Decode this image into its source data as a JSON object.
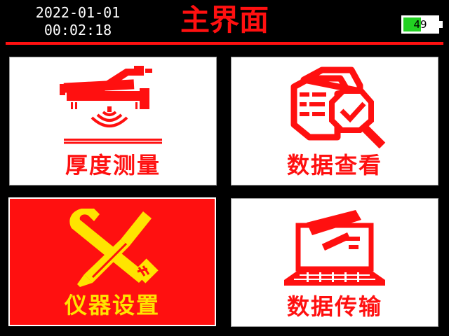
{
  "header": {
    "date": "2022-01-01",
    "time": "00:02:18",
    "title": "主界面",
    "battery_level": 49,
    "battery_text": "49"
  },
  "colors": {
    "accent": "#ff1010",
    "selected_label": "#ffe400",
    "battery_fill": "#22d122"
  },
  "tiles": [
    {
      "label": "厚度测量",
      "icon": "thickness-gauge-icon",
      "selected": false
    },
    {
      "label": "数据查看",
      "icon": "document-search-icon",
      "selected": false
    },
    {
      "label": "仪器设置",
      "icon": "wrench-screwdriver-icon",
      "selected": true
    },
    {
      "label": "数据传输",
      "icon": "laptop-transfer-icon",
      "selected": false
    }
  ]
}
